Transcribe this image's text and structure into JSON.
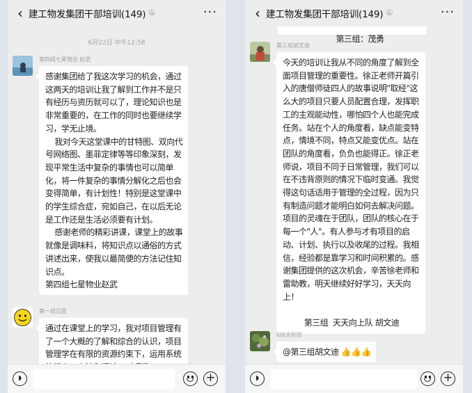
{
  "left": {
    "nav": {
      "back_icon": "chevron-left-icon",
      "title": "建工物发集团干部培训(149)",
      "mute_icon": "mute-bell-icon",
      "more_label": "···"
    },
    "timestamp": "6月22日 中午12:58",
    "messages": [
      {
        "sender": "第四组七星物业 赵武",
        "text": "感谢集团给了我这次学习的机会，通过这两天的培训让我了解到工作并不是只有经历与资历就可以了，理论知识也是非常重要的，在工作的同时也要继续学习，学无止境。\n    我对今天这堂课中的甘特图、双向代号网络图、墨菲定律等等印象深刻，发现平常生活中复杂的事情也可以简单化，将一件复杂的事情分解化之后也会变得简单，有计划性！特别是这堂课中的学生综合症，宛如自己，在以后无论是工作还是生活必须要有计划。\n    感谢老师的精彩讲课，课堂上的故事就像是调味料，将知识点以通俗的方式讲述出来，使我以最简便的方法记住知识点。\n第四组七星物业赵武"
      },
      {
        "sender": "第一组闫亚",
        "text": "通过在课堂上的学习，我对项目管理有了一个大概的了解和综合的认识，项目管理学在有限的资源约束下，运用系统的观点、方法和理论，对项目"
      }
    ],
    "input": {
      "voice_icon": "voice-icon",
      "emoji_icon": "emoji-icon",
      "plus_icon": "plus-icon"
    }
  },
  "right": {
    "nav": {
      "back_icon": "chevron-left-icon",
      "title": "建工物发集团干部培训(149)",
      "mute_icon": "mute-bell-icon",
      "more_label": "···"
    },
    "top_partial_text": "第三组：茂勇",
    "messages": [
      {
        "sender": "第三组胡文迪",
        "text": "今天的培训让我从不同的角度了解到全面项目管理的重要性。徐正老师开篇引入的唐僧师徒四人的故事说明\"取经\"这么大的项目只要人员配置合理，发挥职工的主观能动性，哪怕四个人也能完成任务。站在个人的角度看，缺点能变特点，情境不同，特点又能变优点。站在团队的角度看，负负也能得正。徐正老师说，项目不同于日常管理，我们可以在不违背原则的情况下临时变通。我觉得这句话适用于管理的全过程，因为只有制造问题才能明白如何去解决问题。项目的灵魂在于团队，团队的核心在于每一个\"人\"。有人参与才有项目的启动、计划、执行以及收尾的过程。我相信，经验都是靠学习和时间积累的。感谢集团提供的这次机会，辛苦徐老师和雷助教，明天继续好好学习，天天向上！",
        "signature": "第三组  天天向上队 胡文迪"
      },
      {
        "sender": "6组余利忠",
        "text": "@第三组胡文迪 ",
        "emojis": "👍👍👍"
      }
    ],
    "input": {
      "voice_icon": "voice-icon",
      "emoji_icon": "emoji-icon",
      "plus_icon": "plus-icon"
    }
  },
  "colors": {
    "background": "#ededed",
    "bubble": "#ffffff",
    "text": "#1f1f1f",
    "meta": "#a0a0a0"
  }
}
